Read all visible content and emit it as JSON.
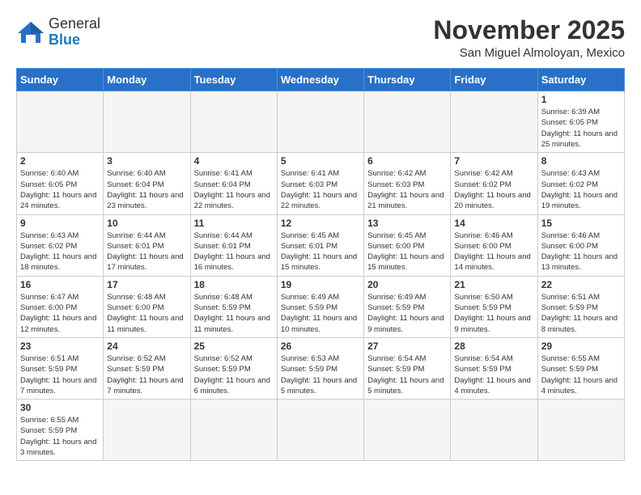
{
  "header": {
    "logo_general": "General",
    "logo_blue": "Blue",
    "month_title": "November 2025",
    "location": "San Miguel Almoloyan, Mexico"
  },
  "weekdays": [
    "Sunday",
    "Monday",
    "Tuesday",
    "Wednesday",
    "Thursday",
    "Friday",
    "Saturday"
  ],
  "days": [
    {
      "num": "",
      "sunrise": "",
      "sunset": "",
      "daylight": "",
      "empty": true
    },
    {
      "num": "",
      "sunrise": "",
      "sunset": "",
      "daylight": "",
      "empty": true
    },
    {
      "num": "",
      "sunrise": "",
      "sunset": "",
      "daylight": "",
      "empty": true
    },
    {
      "num": "",
      "sunrise": "",
      "sunset": "",
      "daylight": "",
      "empty": true
    },
    {
      "num": "",
      "sunrise": "",
      "sunset": "",
      "daylight": "",
      "empty": true
    },
    {
      "num": "",
      "sunrise": "",
      "sunset": "",
      "daylight": "",
      "empty": true
    },
    {
      "num": "1",
      "sunrise": "Sunrise: 6:39 AM",
      "sunset": "Sunset: 6:05 PM",
      "daylight": "Daylight: 11 hours and 25 minutes."
    },
    {
      "num": "2",
      "sunrise": "Sunrise: 6:40 AM",
      "sunset": "Sunset: 6:05 PM",
      "daylight": "Daylight: 11 hours and 24 minutes."
    },
    {
      "num": "3",
      "sunrise": "Sunrise: 6:40 AM",
      "sunset": "Sunset: 6:04 PM",
      "daylight": "Daylight: 11 hours and 23 minutes."
    },
    {
      "num": "4",
      "sunrise": "Sunrise: 6:41 AM",
      "sunset": "Sunset: 6:04 PM",
      "daylight": "Daylight: 11 hours and 22 minutes."
    },
    {
      "num": "5",
      "sunrise": "Sunrise: 6:41 AM",
      "sunset": "Sunset: 6:03 PM",
      "daylight": "Daylight: 11 hours and 22 minutes."
    },
    {
      "num": "6",
      "sunrise": "Sunrise: 6:42 AM",
      "sunset": "Sunset: 6:03 PM",
      "daylight": "Daylight: 11 hours and 21 minutes."
    },
    {
      "num": "7",
      "sunrise": "Sunrise: 6:42 AM",
      "sunset": "Sunset: 6:02 PM",
      "daylight": "Daylight: 11 hours and 20 minutes."
    },
    {
      "num": "8",
      "sunrise": "Sunrise: 6:43 AM",
      "sunset": "Sunset: 6:02 PM",
      "daylight": "Daylight: 11 hours and 19 minutes."
    },
    {
      "num": "9",
      "sunrise": "Sunrise: 6:43 AM",
      "sunset": "Sunset: 6:02 PM",
      "daylight": "Daylight: 11 hours and 18 minutes."
    },
    {
      "num": "10",
      "sunrise": "Sunrise: 6:44 AM",
      "sunset": "Sunset: 6:01 PM",
      "daylight": "Daylight: 11 hours and 17 minutes."
    },
    {
      "num": "11",
      "sunrise": "Sunrise: 6:44 AM",
      "sunset": "Sunset: 6:01 PM",
      "daylight": "Daylight: 11 hours and 16 minutes."
    },
    {
      "num": "12",
      "sunrise": "Sunrise: 6:45 AM",
      "sunset": "Sunset: 6:01 PM",
      "daylight": "Daylight: 11 hours and 15 minutes."
    },
    {
      "num": "13",
      "sunrise": "Sunrise: 6:45 AM",
      "sunset": "Sunset: 6:00 PM",
      "daylight": "Daylight: 11 hours and 15 minutes."
    },
    {
      "num": "14",
      "sunrise": "Sunrise: 6:46 AM",
      "sunset": "Sunset: 6:00 PM",
      "daylight": "Daylight: 11 hours and 14 minutes."
    },
    {
      "num": "15",
      "sunrise": "Sunrise: 6:46 AM",
      "sunset": "Sunset: 6:00 PM",
      "daylight": "Daylight: 11 hours and 13 minutes."
    },
    {
      "num": "16",
      "sunrise": "Sunrise: 6:47 AM",
      "sunset": "Sunset: 6:00 PM",
      "daylight": "Daylight: 11 hours and 12 minutes."
    },
    {
      "num": "17",
      "sunrise": "Sunrise: 6:48 AM",
      "sunset": "Sunset: 6:00 PM",
      "daylight": "Daylight: 11 hours and 11 minutes."
    },
    {
      "num": "18",
      "sunrise": "Sunrise: 6:48 AM",
      "sunset": "Sunset: 5:59 PM",
      "daylight": "Daylight: 11 hours and 11 minutes."
    },
    {
      "num": "19",
      "sunrise": "Sunrise: 6:49 AM",
      "sunset": "Sunset: 5:59 PM",
      "daylight": "Daylight: 11 hours and 10 minutes."
    },
    {
      "num": "20",
      "sunrise": "Sunrise: 6:49 AM",
      "sunset": "Sunset: 5:59 PM",
      "daylight": "Daylight: 11 hours and 9 minutes."
    },
    {
      "num": "21",
      "sunrise": "Sunrise: 6:50 AM",
      "sunset": "Sunset: 5:59 PM",
      "daylight": "Daylight: 11 hours and 9 minutes."
    },
    {
      "num": "22",
      "sunrise": "Sunrise: 6:51 AM",
      "sunset": "Sunset: 5:59 PM",
      "daylight": "Daylight: 11 hours and 8 minutes."
    },
    {
      "num": "23",
      "sunrise": "Sunrise: 6:51 AM",
      "sunset": "Sunset: 5:59 PM",
      "daylight": "Daylight: 11 hours and 7 minutes."
    },
    {
      "num": "24",
      "sunrise": "Sunrise: 6:52 AM",
      "sunset": "Sunset: 5:59 PM",
      "daylight": "Daylight: 11 hours and 7 minutes."
    },
    {
      "num": "25",
      "sunrise": "Sunrise: 6:52 AM",
      "sunset": "Sunset: 5:59 PM",
      "daylight": "Daylight: 11 hours and 6 minutes."
    },
    {
      "num": "26",
      "sunrise": "Sunrise: 6:53 AM",
      "sunset": "Sunset: 5:59 PM",
      "daylight": "Daylight: 11 hours and 5 minutes."
    },
    {
      "num": "27",
      "sunrise": "Sunrise: 6:54 AM",
      "sunset": "Sunset: 5:59 PM",
      "daylight": "Daylight: 11 hours and 5 minutes."
    },
    {
      "num": "28",
      "sunrise": "Sunrise: 6:54 AM",
      "sunset": "Sunset: 5:59 PM",
      "daylight": "Daylight: 11 hours and 4 minutes."
    },
    {
      "num": "29",
      "sunrise": "Sunrise: 6:55 AM",
      "sunset": "Sunset: 5:59 PM",
      "daylight": "Daylight: 11 hours and 4 minutes."
    },
    {
      "num": "30",
      "sunrise": "Sunrise: 6:55 AM",
      "sunset": "Sunset: 5:59 PM",
      "daylight": "Daylight: 11 hours and 3 minutes."
    }
  ]
}
